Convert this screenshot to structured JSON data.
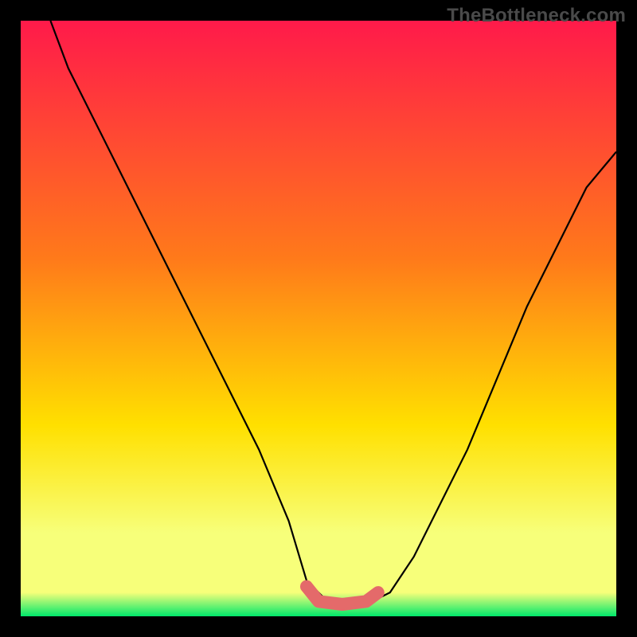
{
  "watermark": "TheBottleneck.com",
  "colors": {
    "frame_bg": "#000000",
    "gradient_top": "#ff1a4a",
    "gradient_upper_mid": "#ff7a1a",
    "gradient_mid": "#ffe000",
    "gradient_low": "#f7ff7a",
    "gradient_bottom": "#00e86b",
    "curve_stroke": "#000000",
    "highlight_stroke": "#e46a6a",
    "watermark_text": "#4a4a4a"
  },
  "chart_data": {
    "type": "line",
    "title": "",
    "xlabel": "",
    "ylabel": "",
    "xlim": [
      0,
      100
    ],
    "ylim": [
      0,
      100
    ],
    "series": [
      {
        "name": "bottleneck-curve",
        "x": [
          5,
          8,
          12,
          16,
          20,
          25,
          30,
          35,
          40,
          45,
          48,
          52,
          56,
          58,
          62,
          66,
          70,
          75,
          80,
          85,
          90,
          95,
          100
        ],
        "y": [
          100,
          92,
          84,
          76,
          68,
          58,
          48,
          38,
          28,
          16,
          6,
          2,
          2,
          2,
          4,
          10,
          18,
          28,
          40,
          52,
          62,
          72,
          78
        ]
      }
    ],
    "highlight_region": {
      "name": "optimal-zone",
      "x": [
        48,
        50,
        54,
        58,
        60
      ],
      "y": [
        5,
        2.5,
        2,
        2.5,
        4
      ]
    },
    "gradient_stops_pct": [
      0,
      40,
      68,
      86,
      96,
      100
    ]
  }
}
